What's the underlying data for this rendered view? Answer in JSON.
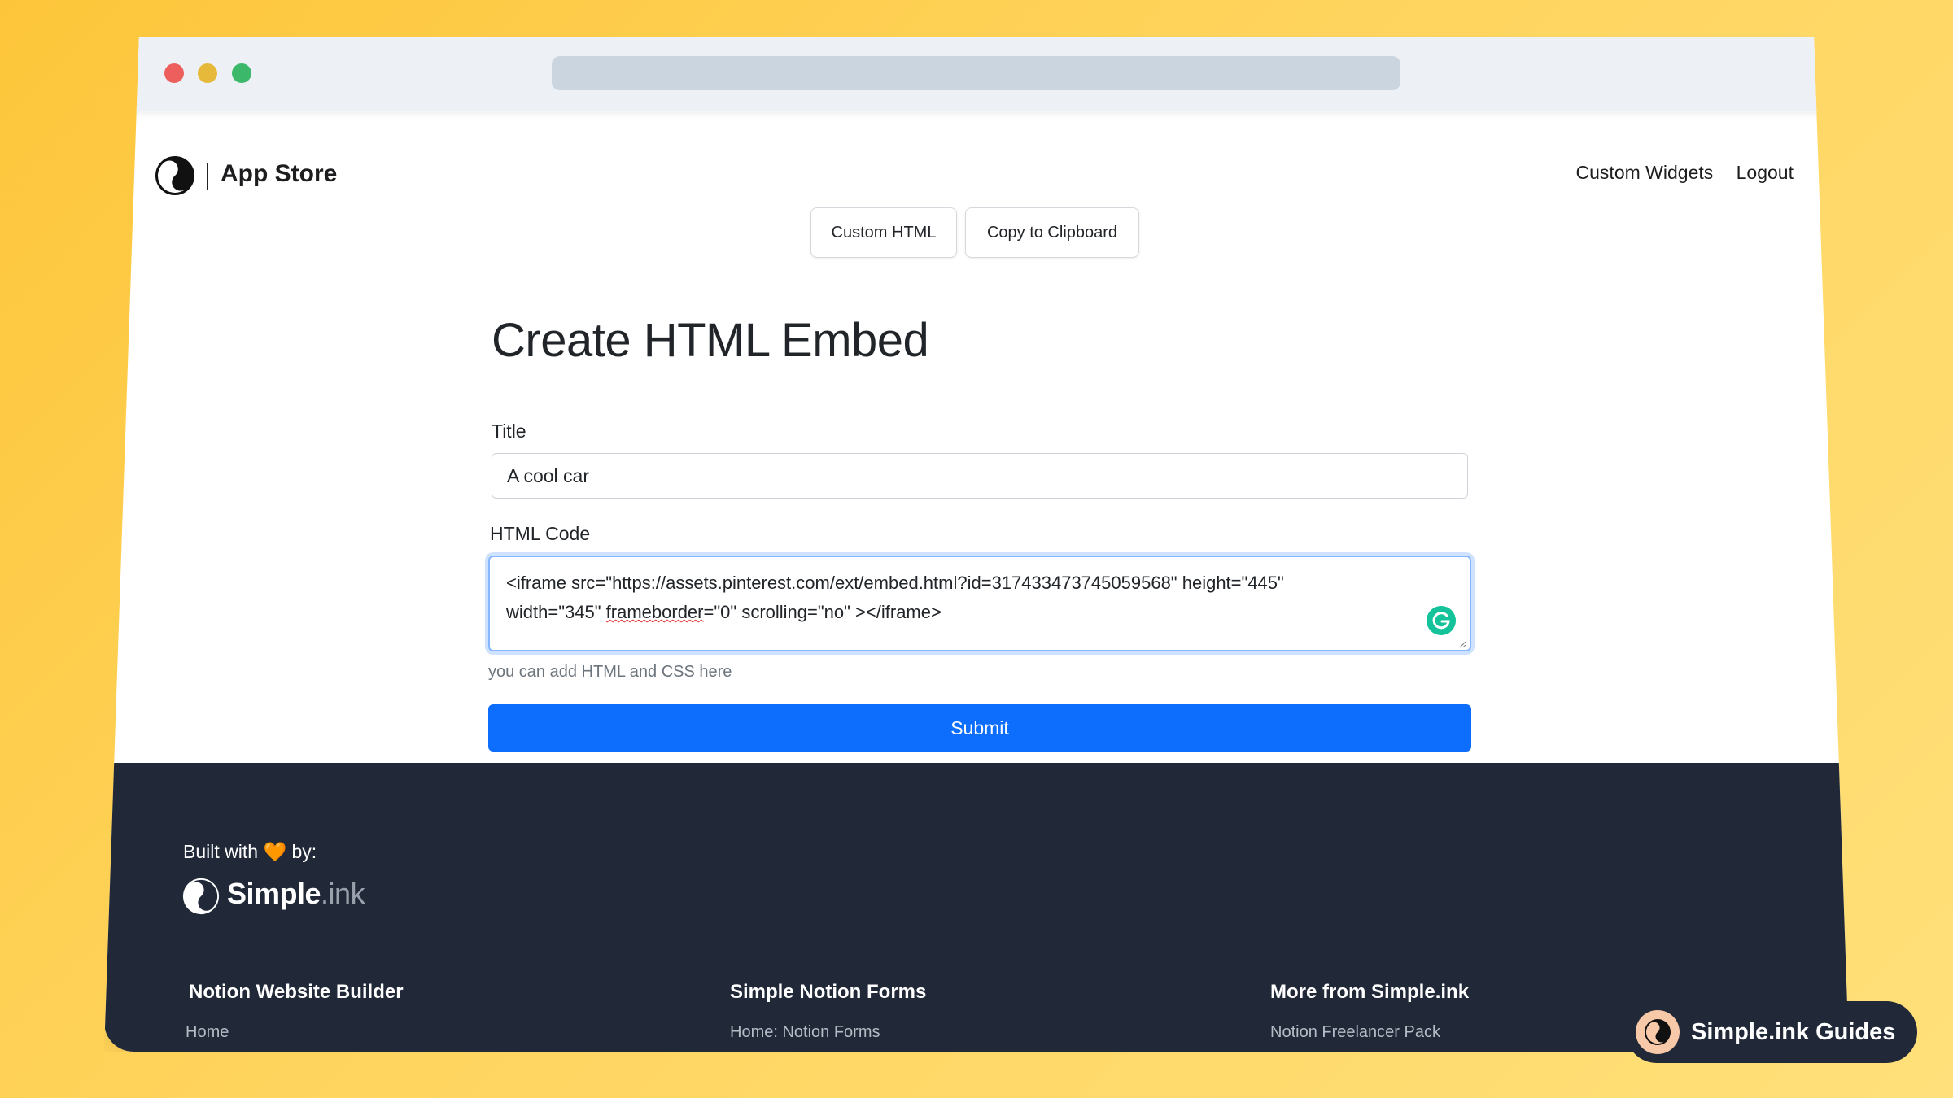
{
  "navbar": {
    "brand": "App Store",
    "links": [
      "Custom Widgets",
      "Logout"
    ]
  },
  "toolbar": {
    "custom_html": "Custom HTML",
    "copy": "Copy to Clipboard"
  },
  "form": {
    "heading": "Create HTML Embed",
    "title_label": "Title",
    "title_value": "A cool car",
    "code_label": "HTML Code",
    "code_line1": "<iframe src=\"https://assets.pinterest.com/ext/embed.html?id=317433473745059568\" height=\"445\"",
    "code_line2_pre": "width=\"345\" ",
    "code_line2_squiggle": "frameborder",
    "code_line2_post": "=\"0\" scrolling=\"no\" ></iframe>",
    "help": "you can add HTML and CSS here",
    "submit": "Submit"
  },
  "footer": {
    "built_pre": "Built with",
    "heart": "🧡",
    "built_post": "by:",
    "logo_word": "Simple",
    "logo_suffix": ".ink",
    "columns": [
      {
        "heading": "Notion Website Builder",
        "link": "Home"
      },
      {
        "heading": "Simple Notion Forms",
        "link": "Home: Notion Forms"
      },
      {
        "heading": "More from Simple.ink",
        "link": "Notion Freelancer Pack"
      }
    ]
  },
  "badge": {
    "label": "Simple.ink Guides"
  },
  "colors": {
    "primary": "#0d6efd",
    "footer_bg": "#212938",
    "background": "#fdc63a",
    "grammarly": "#15c39a"
  },
  "icons": [
    "yin-yang-logo-icon",
    "grammarly-icon",
    "heart-icon"
  ]
}
